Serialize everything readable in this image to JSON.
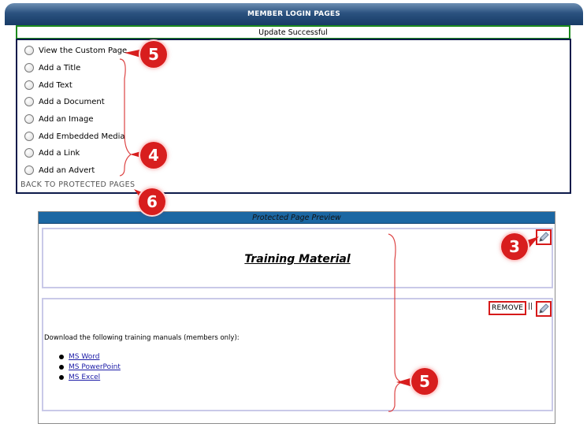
{
  "header": {
    "title": "MEMBER LOGIN PAGES"
  },
  "status": {
    "message": "Update Successful"
  },
  "menu": {
    "options": [
      {
        "label": "View the Custom Page"
      },
      {
        "label": "Add a Title"
      },
      {
        "label": "Add Text"
      },
      {
        "label": "Add a Document"
      },
      {
        "label": "Add an Image"
      },
      {
        "label": "Add Embedded Media"
      },
      {
        "label": "Add a Link"
      },
      {
        "label": "Add an Advert"
      }
    ],
    "back_link": "BACK TO PROTECTED PAGES"
  },
  "preview": {
    "bar_title": "Protected Page Preview",
    "page_title": "Training Material",
    "remove_label": "REMOVE",
    "separator": "||",
    "intro_text": "Download the following training manuals (members only):",
    "links": [
      "MS Word",
      "MS PowerPoint",
      "MS Excel"
    ]
  },
  "callouts": {
    "a": "5",
    "b": "4",
    "c": "6",
    "d": "3",
    "e": "5"
  },
  "colors": {
    "header": "#2b527f",
    "status_border": "#1c8a1c",
    "menu_border": "#0d1a4a",
    "preview_bar": "#1b67a3",
    "callout": "#d81e1e",
    "link": "#1a1aa6"
  }
}
